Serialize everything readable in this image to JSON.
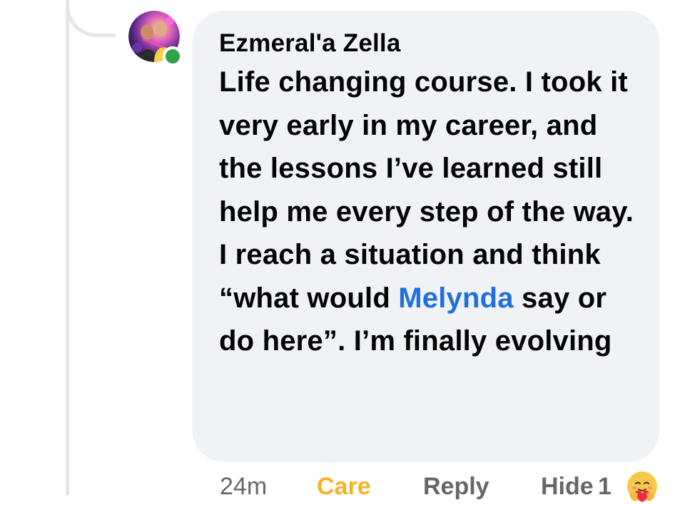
{
  "comment": {
    "author": "Ezmeral'a Zella",
    "text_before_mention": "Life changing course. I took it very early in my career, and the lessons I’ve learned still help me every step of the way. I reach a situation and think “what would ",
    "mention": "Melynda",
    "text_after_mention": " say or do here”. I’m finally evolving",
    "author_online": true
  },
  "actions": {
    "time": "24m",
    "reaction_label": "Care",
    "reply_label": "Reply",
    "hide_label": "Hide",
    "reaction_count": "1",
    "reaction_icon": "care-emoji-icon"
  },
  "colors": {
    "bubble": "#f0f2f5",
    "mention": "#216fdb",
    "care": "#f7b125",
    "online": "#31a24c",
    "muted": "#65676b"
  }
}
